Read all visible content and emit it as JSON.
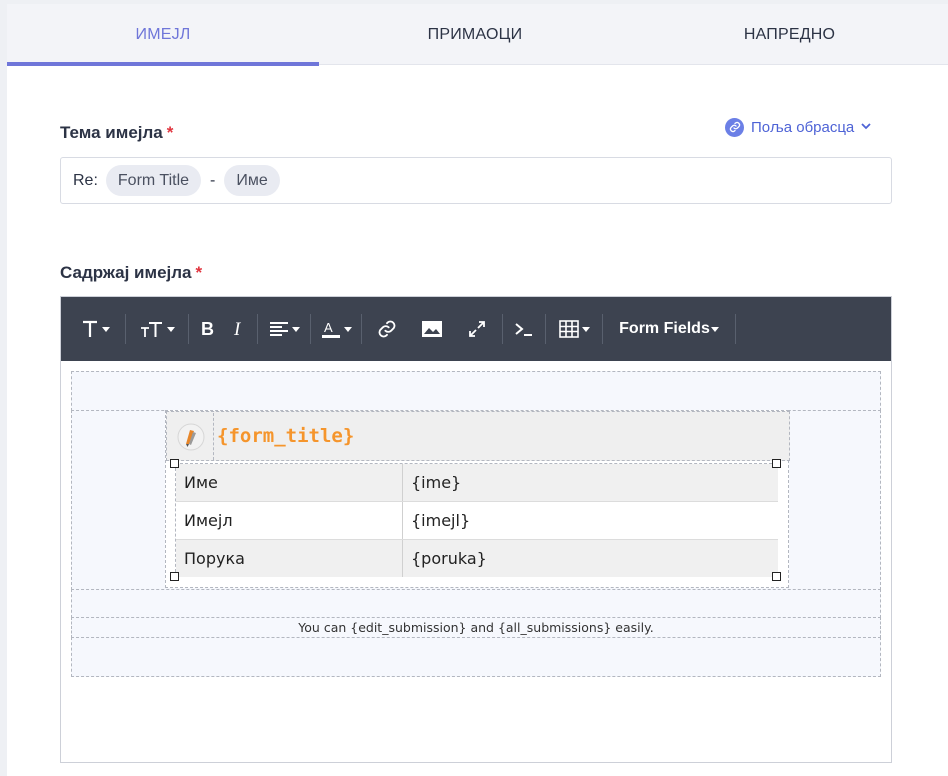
{
  "tabs": [
    {
      "label": "ИМЕЈЛ",
      "active": true
    },
    {
      "label": "ПРИМАОЦИ",
      "active": false
    },
    {
      "label": "НАПРЕДНО",
      "active": false
    }
  ],
  "subject": {
    "label": "Тема имејла",
    "required_mark": "*",
    "prefix": "Re:",
    "chips": [
      "Form Title",
      "Име"
    ],
    "separator": "-"
  },
  "form_fields_link": {
    "label": "Поља обрасца",
    "icon": "link-icon"
  },
  "body": {
    "label": "Садржај имејла",
    "required_mark": "*"
  },
  "toolbar": {
    "buttons": [
      "text-style",
      "font-size",
      "bold",
      "italic",
      "align",
      "text-color",
      "link",
      "image",
      "fullscreen",
      "code",
      "table"
    ],
    "form_fields_label": "Form Fields"
  },
  "email_template": {
    "form_title": "{form_title}",
    "rows": [
      {
        "label": "Име",
        "value": "{ime}"
      },
      {
        "label": "Имејл",
        "value": "{imejl}"
      },
      {
        "label": "Порука",
        "value": "{poruka}"
      }
    ],
    "footer_text": "You can {edit_submission} and {all_submissions} easily."
  },
  "colors": {
    "accent": "#6f76d9",
    "toolbar_bg": "#3d4350",
    "required": "#e0323c",
    "form_title": "#f5952c",
    "link": "#4e63d6"
  }
}
